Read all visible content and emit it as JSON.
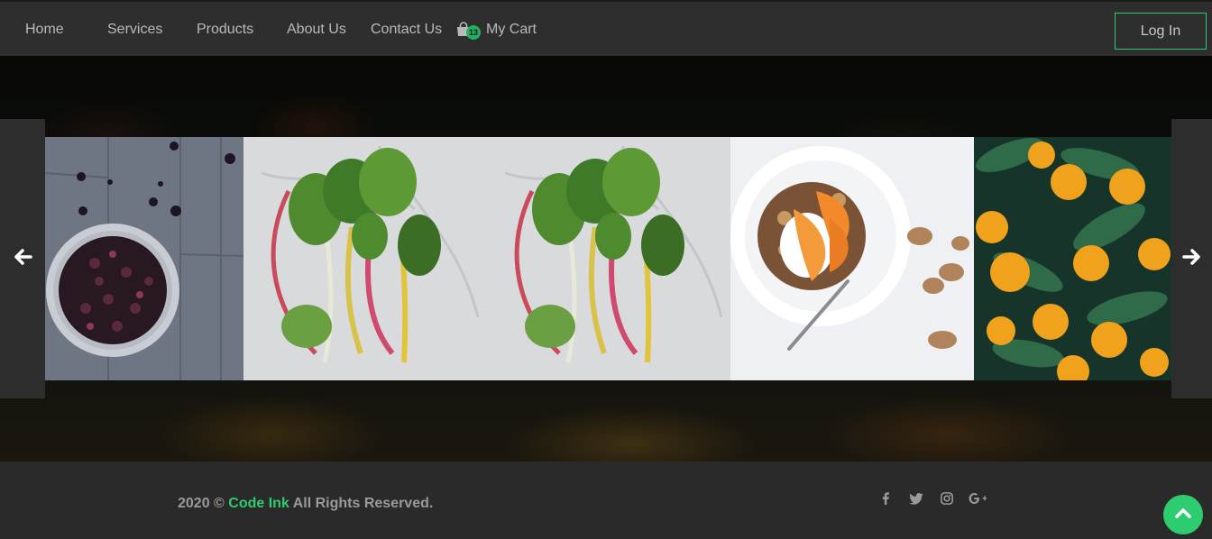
{
  "nav": {
    "items": [
      {
        "label": "Home"
      },
      {
        "label": "Services"
      },
      {
        "label": "Products"
      },
      {
        "label": "About Us"
      },
      {
        "label": "Contact Us"
      }
    ],
    "cart": {
      "label": "My Cart",
      "count": "13",
      "icon": "shopping-bag-icon"
    },
    "login_label": "Log In"
  },
  "slider": {
    "prev_icon": "arrow-left-icon",
    "next_icon": "arrow-right-icon"
  },
  "footer": {
    "year_text": "2020 ©",
    "brand": "Code Ink",
    "rights": "All Rights Reserved.",
    "socials": [
      "facebook-icon",
      "twitter-icon",
      "instagram-icon",
      "google-plus-icon"
    ],
    "back_to_top_icon": "chevron-up-icon"
  },
  "colors": {
    "accent": "#2ecc71",
    "nav_bg": "#2f2e2e",
    "footer_bg": "#2b2a2a",
    "nav_text": "#b9b9b9"
  }
}
